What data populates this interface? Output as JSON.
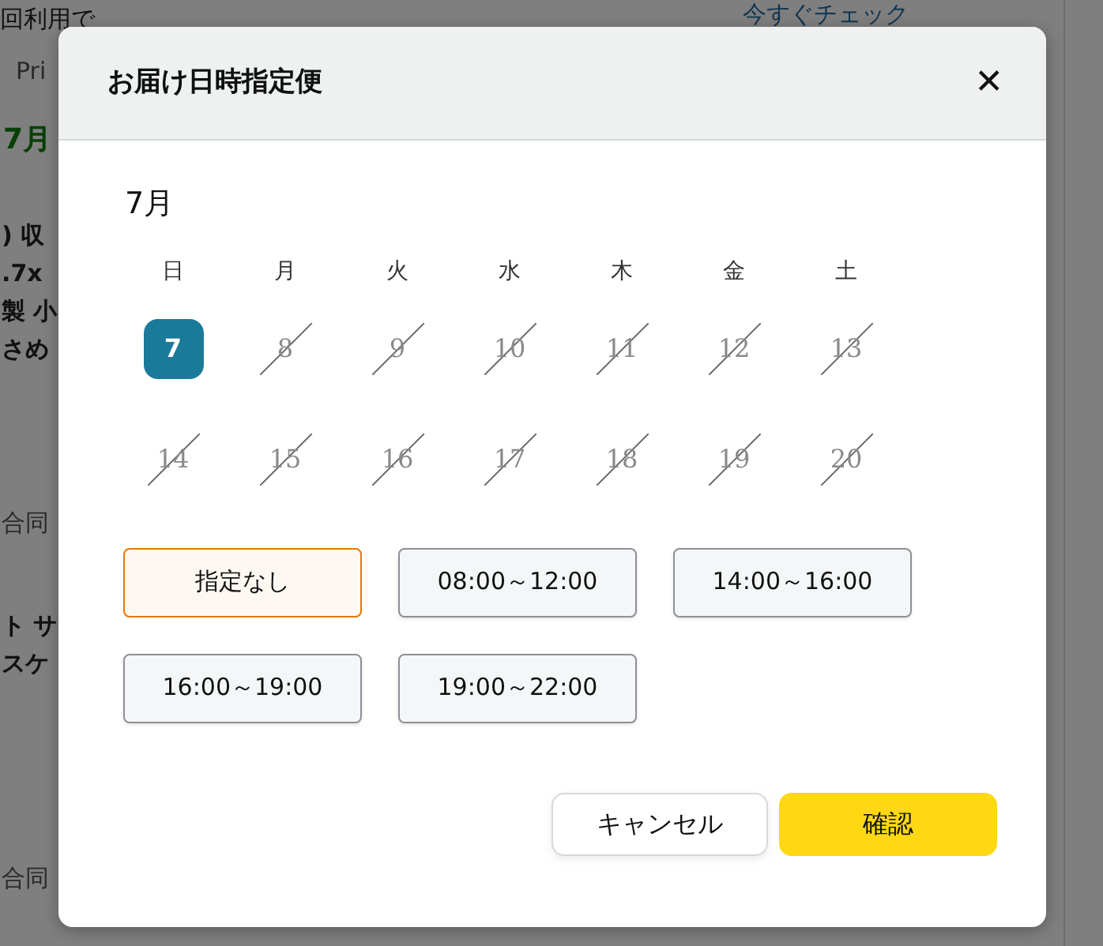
{
  "background": {
    "texts": [
      {
        "text": "回利用で",
        "kind": "plain"
      },
      {
        "text": "今すぐチェック",
        "kind": "link"
      },
      {
        "text": "Pri",
        "kind": "muted"
      },
      {
        "text": "7月",
        "kind": "green"
      },
      {
        "text": ") 収",
        "kind": "bold"
      },
      {
        "text": ".7x",
        "kind": "bold"
      },
      {
        "text": "製 小",
        "kind": "bold"
      },
      {
        "text": "さめ",
        "kind": "bold"
      },
      {
        "text": "合同",
        "kind": "muted"
      },
      {
        "text": "ト サ",
        "kind": "bold"
      },
      {
        "text": "スケ",
        "kind": "bold"
      },
      {
        "text": "合同",
        "kind": "muted"
      }
    ]
  },
  "dialog": {
    "title": "お届け日時指定便",
    "close": "✕",
    "month": "7月",
    "weekdays": [
      "日",
      "月",
      "火",
      "水",
      "木",
      "金",
      "土"
    ],
    "weeks": [
      [
        {
          "day": "7",
          "available": true,
          "selected": true
        },
        {
          "day": "8",
          "available": false,
          "selected": false
        },
        {
          "day": "9",
          "available": false,
          "selected": false
        },
        {
          "day": "10",
          "available": false,
          "selected": false
        },
        {
          "day": "11",
          "available": false,
          "selected": false
        },
        {
          "day": "12",
          "available": false,
          "selected": false
        },
        {
          "day": "13",
          "available": false,
          "selected": false
        }
      ],
      [
        {
          "day": "14",
          "available": false,
          "selected": false
        },
        {
          "day": "15",
          "available": false,
          "selected": false
        },
        {
          "day": "16",
          "available": false,
          "selected": false
        },
        {
          "day": "17",
          "available": false,
          "selected": false
        },
        {
          "day": "18",
          "available": false,
          "selected": false
        },
        {
          "day": "19",
          "available": false,
          "selected": false
        },
        {
          "day": "20",
          "available": false,
          "selected": false
        }
      ]
    ],
    "time_slots": [
      {
        "label": "指定なし",
        "selected": true
      },
      {
        "label": "08:00～12:00",
        "selected": false
      },
      {
        "label": "14:00～16:00",
        "selected": false
      },
      {
        "label": "16:00～19:00",
        "selected": false
      },
      {
        "label": "19:00～22:00",
        "selected": false
      }
    ],
    "buttons": [
      {
        "label": "キャンセル",
        "kind": "secondary"
      },
      {
        "label": "確認",
        "kind": "primary"
      }
    ]
  }
}
